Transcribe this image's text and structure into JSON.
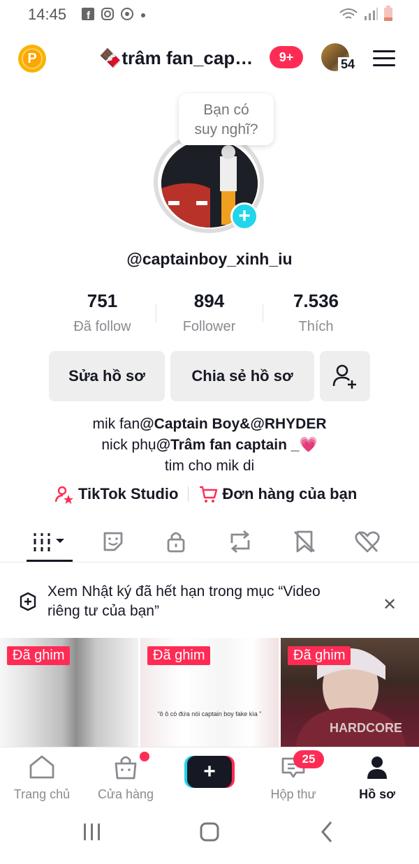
{
  "status_bar": {
    "time": "14:45"
  },
  "header": {
    "username": "🍫trâm fan_cap…",
    "notification_count": "9+",
    "avatar_count": "54"
  },
  "profile": {
    "bubble_text_line1": "Bạn có",
    "bubble_text_line2": "suy nghĩ?",
    "handle": "@captainboy_xinh_iu",
    "stats": [
      {
        "value": "751",
        "label": "Đã follow"
      },
      {
        "value": "894",
        "label": "Follower"
      },
      {
        "value": "7.536",
        "label": "Thích"
      }
    ],
    "buttons": {
      "edit": "Sửa hồ sơ",
      "share": "Chia sẻ hồ sơ"
    },
    "bio": {
      "line1_prefix": "mik fan",
      "line1_bold": "@Captain Boy",
      "line1_mid": "&",
      "line1_bold2": "@RHYDER",
      "line2_prefix": "nick phụ",
      "line2_bold": "@Trâm fan captain _",
      "line2_emoji": "💗",
      "line3": "tim cho mik di"
    },
    "links": {
      "studio": "TikTok Studio",
      "orders": "Đơn hàng của bạn"
    }
  },
  "tabs": [
    {
      "icon": "grid-icon",
      "selected": true
    },
    {
      "icon": "sticker-icon"
    },
    {
      "icon": "lock-icon"
    },
    {
      "icon": "repost-icon"
    },
    {
      "icon": "bookmark-hidden-icon"
    },
    {
      "icon": "heart-hidden-icon"
    }
  ],
  "notice": {
    "line1": "Xem Nhật ký đã hết hạn trong mục “Video",
    "line2": "riêng tư của bạn”"
  },
  "videos": [
    {
      "pinned_label": "Đã ghim",
      "caption": ""
    },
    {
      "pinned_label": "Đã ghim",
      "caption": "“ô ô có đứa nói captain boy fake kìa ”"
    },
    {
      "pinned_label": "Đã ghim",
      "caption": ""
    }
  ],
  "bottom_nav": [
    {
      "label": "Trang chủ",
      "icon": "home-icon"
    },
    {
      "label": "Cửa hàng",
      "icon": "shop-icon"
    },
    {
      "label": "",
      "icon": "create-icon"
    },
    {
      "label": "Hộp thư",
      "icon": "inbox-icon"
    },
    {
      "label": "Hồ sơ",
      "icon": "profile-icon",
      "selected": true
    }
  ],
  "inbox_count": "25",
  "colors": {
    "accent": "#fe2c55",
    "cyan": "#20d5ec",
    "text": "#161823",
    "muted": "#8a8b91"
  }
}
